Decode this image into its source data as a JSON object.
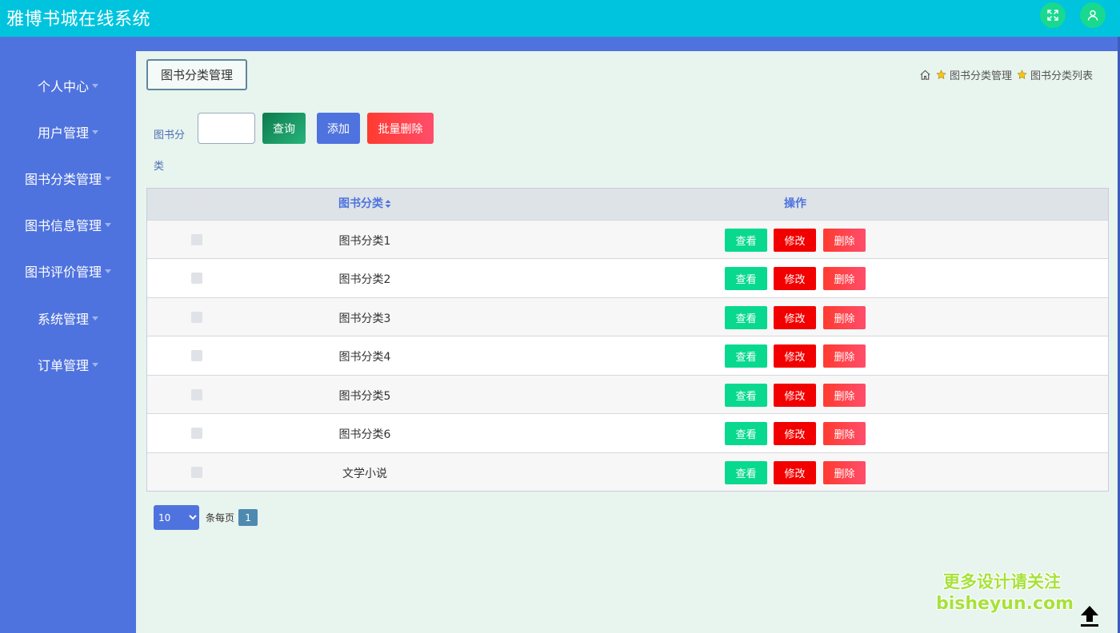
{
  "app": {
    "title": "雅博书城在线系统"
  },
  "header": {
    "fullscreen_icon": "fullscreen-icon",
    "user_icon": "user-icon"
  },
  "sidebar": {
    "items": [
      {
        "label": "个人中心"
      },
      {
        "label": "用户管理"
      },
      {
        "label": "图书分类管理"
      },
      {
        "label": "图书信息管理"
      },
      {
        "label": "图书评价管理"
      },
      {
        "label": "系统管理"
      },
      {
        "label": "订单管理"
      }
    ]
  },
  "page": {
    "tag": "图书分类管理"
  },
  "breadcrumb": {
    "items": [
      "图书分类管理",
      "图书分类列表"
    ]
  },
  "search": {
    "label": "图书分类",
    "value": "",
    "query": "查询",
    "add": "添加",
    "batch_delete": "批量删除"
  },
  "table": {
    "headers": {
      "category": "图书分类",
      "actions": "操作"
    },
    "rows": [
      {
        "category": "图书分类1"
      },
      {
        "category": "图书分类2"
      },
      {
        "category": "图书分类3"
      },
      {
        "category": "图书分类4"
      },
      {
        "category": "图书分类5"
      },
      {
        "category": "图书分类6"
      },
      {
        "category": "文学小说"
      }
    ],
    "actions": {
      "view": "查看",
      "edit": "修改",
      "delete": "删除"
    }
  },
  "pagination": {
    "page_size": "10",
    "per_page_label": "条每页",
    "current_page": "1"
  },
  "watermark": {
    "line1": "更多设计请关注",
    "line2": "bisheyun.com"
  },
  "colors": {
    "topbar": "#00c4dd",
    "sidebar": "#4f73de",
    "accent_green": "#09d98f",
    "edit_red": "#f20000"
  }
}
